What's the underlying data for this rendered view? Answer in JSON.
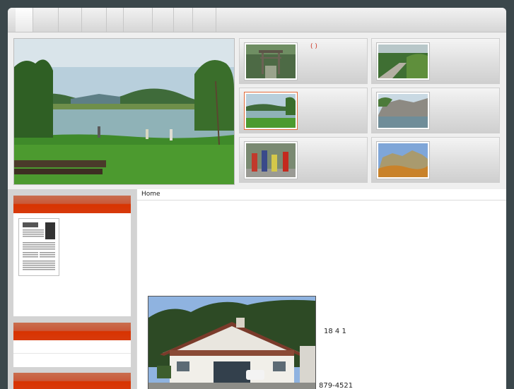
{
  "nav": {
    "items": [
      {
        "label": ""
      },
      {
        "label": ""
      },
      {
        "label": ""
      },
      {
        "label": ""
      },
      {
        "label": ""
      },
      {
        "label": ""
      },
      {
        "label": ""
      },
      {
        "label": ""
      },
      {
        "label": ""
      }
    ]
  },
  "hero": {
    "tiles": [
      {
        "name": "shrine-gate",
        "caption": "(   )"
      },
      {
        "name": "forest-path",
        "caption": ""
      },
      {
        "name": "lake",
        "caption": ""
      },
      {
        "name": "cliff-lake",
        "caption": ""
      },
      {
        "name": "festival",
        "caption": ""
      },
      {
        "name": "rock-formation",
        "caption": ""
      }
    ]
  },
  "breadcrumb": {
    "home": "Home"
  },
  "info": {
    "line1": "18 4 1",
    "line2": "879-4521"
  },
  "colors": {
    "background": "#3b474b",
    "sidebar_header": "#d83300",
    "thumb_selected_border": "#e06b3a"
  }
}
